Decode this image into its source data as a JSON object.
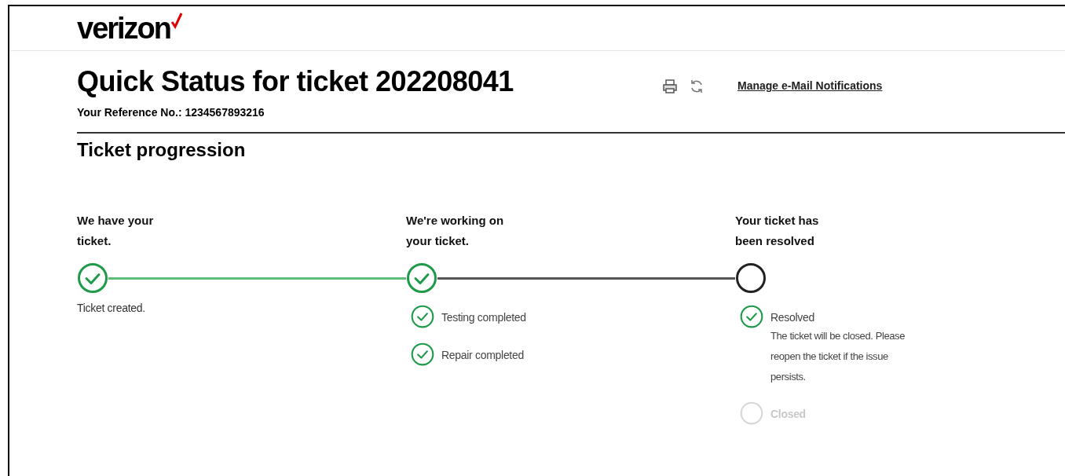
{
  "logo": {
    "text": "verizon"
  },
  "header": {
    "title": "Quick Status for ticket 202208041",
    "reference": "Your Reference No.: 1234567893216",
    "link": "Manage e-Mail Notifications"
  },
  "section": {
    "title": "Ticket progression"
  },
  "stages": [
    {
      "title": "We have your ticket.",
      "done": true,
      "items": [
        {
          "kind": "note",
          "text": "Ticket created."
        }
      ]
    },
    {
      "title": "We're working on your ticket.",
      "done": true,
      "items": [
        {
          "kind": "step",
          "text": "Testing completed",
          "done": true
        },
        {
          "kind": "step",
          "text": "Repair completed",
          "done": true
        }
      ]
    },
    {
      "title": "Your ticket has been resolved",
      "done": false,
      "items": [
        {
          "kind": "step",
          "text": "Resolved",
          "detail": "The ticket will be closed. Please reopen the ticket if the issue persists.",
          "done": true
        },
        {
          "kind": "step",
          "text": "Closed",
          "done": false
        }
      ]
    }
  ]
}
